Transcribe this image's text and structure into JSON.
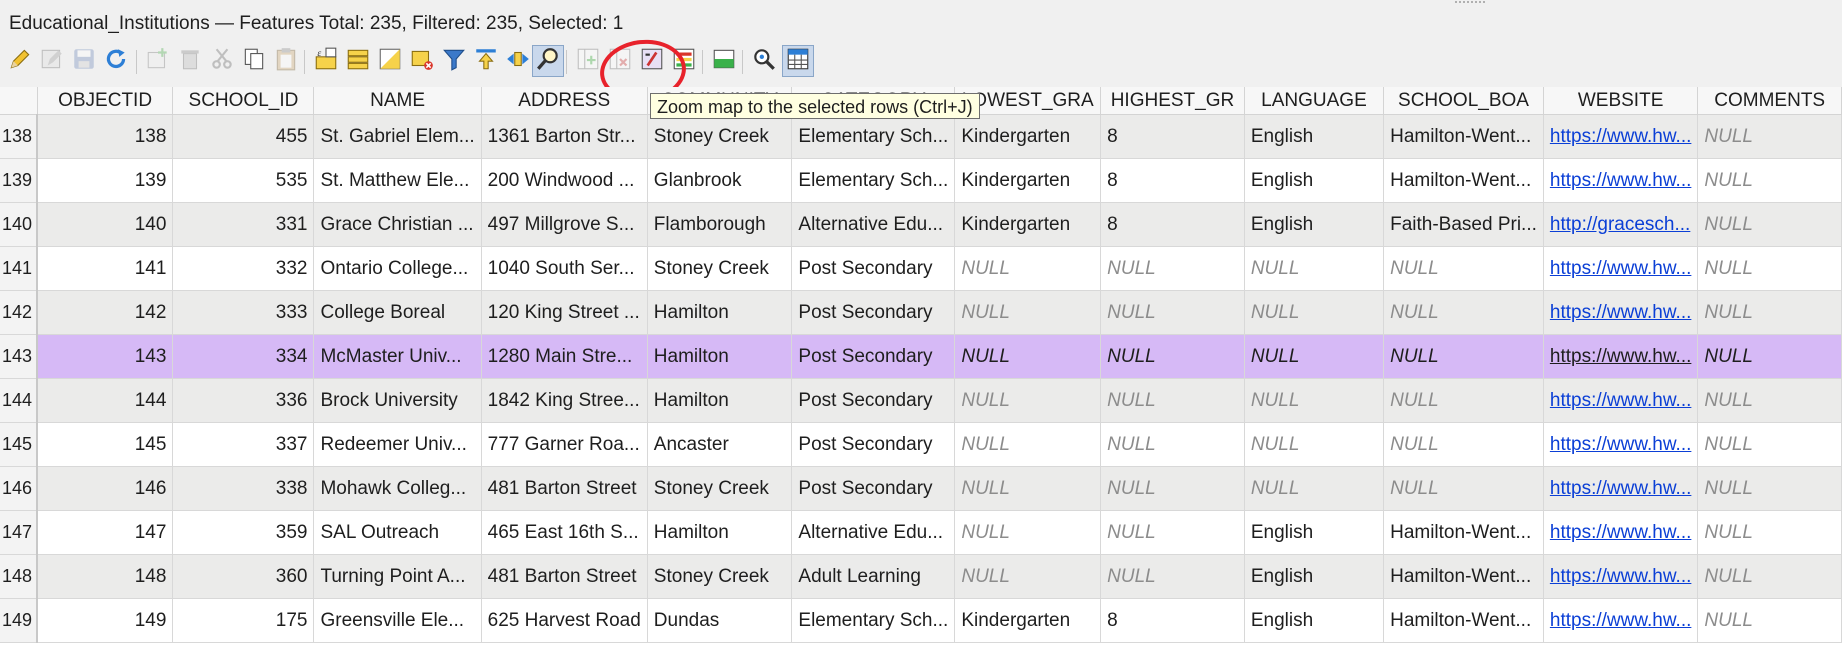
{
  "window": {
    "title": "Educational_Institutions — Features Total: 235, Filtered: 235, Selected: 1"
  },
  "toolbar": {
    "buttons": [
      {
        "icon": "pencil-icon",
        "label": "Toggle editing mode",
        "enabled": true
      },
      {
        "icon": "multi-edit-icon",
        "label": "Toggle multi edit mode",
        "enabled": false
      },
      {
        "icon": "save-icon",
        "label": "Save edits",
        "enabled": false
      },
      {
        "icon": "reload-icon",
        "label": "Reload the table",
        "enabled": true
      },
      {
        "icon": "add-feature-icon",
        "label": "Add feature",
        "enabled": false
      },
      {
        "icon": "delete-icon",
        "label": "Delete selected features",
        "enabled": false
      },
      {
        "icon": "cut-icon",
        "label": "Cut selected rows",
        "enabled": false
      },
      {
        "icon": "copy-icon",
        "label": "Copy selected rows",
        "enabled": true
      },
      {
        "icon": "paste-icon",
        "label": "Paste features",
        "enabled": false
      },
      {
        "icon": "expression-select-icon",
        "label": "Select features using an expression",
        "enabled": true
      },
      {
        "icon": "select-all-icon",
        "label": "Select all",
        "enabled": true
      },
      {
        "icon": "invert-selection-icon",
        "label": "Invert selection",
        "enabled": true
      },
      {
        "icon": "deselect-icon",
        "label": "Deselect all",
        "enabled": true
      },
      {
        "icon": "filter-icon",
        "label": "Filter/Select features using form",
        "enabled": true
      },
      {
        "icon": "move-to-top-icon",
        "label": "Move selection to top",
        "enabled": true
      },
      {
        "icon": "pan-to-selected-icon",
        "label": "Pan map to the selected rows",
        "enabled": true
      },
      {
        "icon": "zoom-to-selected-icon",
        "label": "Zoom map to the selected rows",
        "enabled": true
      },
      {
        "icon": "new-field-icon",
        "label": "New field",
        "enabled": false
      },
      {
        "icon": "delete-field-icon",
        "label": "Delete field",
        "enabled": false
      },
      {
        "icon": "field-calculator-icon",
        "label": "Open field calculator",
        "enabled": true
      },
      {
        "icon": "conditional-formatting-icon",
        "label": "Conditional formatting",
        "enabled": true
      },
      {
        "icon": "dock-icon",
        "label": "Dock attribute table",
        "enabled": true
      },
      {
        "icon": "actions-icon",
        "label": "Actions",
        "enabled": true
      },
      {
        "icon": "table-view-icon",
        "label": "Switch to table view",
        "enabled": true
      }
    ],
    "tooltip": "Zoom map to the selected rows (Ctrl+J)"
  },
  "columns": [
    "OBJECTID",
    "SCHOOL_ID",
    "NAME",
    "ADDRESS",
    "COMMUNITY",
    "CATEGORY",
    "LOWEST_GRA",
    "HIGHEST_GR",
    "LANGUAGE",
    "SCHOOL_BOA",
    "WEBSITE",
    "COMMENTS"
  ],
  "rows": [
    {
      "rownum": "138",
      "cells": [
        "138",
        "455",
        "St. Gabriel Elem...",
        "1361 Barton Str...",
        "Stoney Creek",
        "Elementary Sch...",
        "Kindergarten",
        "8",
        "English",
        "Hamilton-Went...",
        "https://www.hw...",
        "NULL"
      ]
    },
    {
      "rownum": "139",
      "cells": [
        "139",
        "535",
        "St. Matthew Ele...",
        "200 Windwood ...",
        "Glanbrook",
        "Elementary Sch...",
        "Kindergarten",
        "8",
        "English",
        "Hamilton-Went...",
        "https://www.hw...",
        "NULL"
      ]
    },
    {
      "rownum": "140",
      "cells": [
        "140",
        "331",
        "Grace Christian ...",
        "497 Millgrove S...",
        "Flamborough",
        "Alternative Edu...",
        "Kindergarten",
        "8",
        "English",
        "Faith-Based Pri...",
        "http://gracesch...",
        "NULL"
      ]
    },
    {
      "rownum": "141",
      "cells": [
        "141",
        "332",
        "Ontario College...",
        "1040 South Ser...",
        "Stoney Creek",
        "Post Secondary",
        "NULL",
        "NULL",
        "NULL",
        "NULL",
        "https://www.hw...",
        "NULL"
      ]
    },
    {
      "rownum": "142",
      "cells": [
        "142",
        "333",
        "College Boreal",
        "120 King Street ...",
        "Hamilton",
        "Post Secondary",
        "NULL",
        "NULL",
        "NULL",
        "NULL",
        "https://www.hw...",
        "NULL"
      ]
    },
    {
      "rownum": "143",
      "cells": [
        "143",
        "334",
        "McMaster Univ...",
        "1280 Main Stre...",
        "Hamilton",
        "Post Secondary",
        "NULL",
        "NULL",
        "NULL",
        "NULL",
        "https://www.hw...",
        "NULL"
      ],
      "selected": true
    },
    {
      "rownum": "144",
      "cells": [
        "144",
        "336",
        "Brock University",
        "1842 King Stree...",
        "Hamilton",
        "Post Secondary",
        "NULL",
        "NULL",
        "NULL",
        "NULL",
        "https://www.hw...",
        "NULL"
      ]
    },
    {
      "rownum": "145",
      "cells": [
        "145",
        "337",
        "Redeemer Univ...",
        "777 Garner Roa...",
        "Ancaster",
        "Post Secondary",
        "NULL",
        "NULL",
        "NULL",
        "NULL",
        "https://www.hw...",
        "NULL"
      ]
    },
    {
      "rownum": "146",
      "cells": [
        "146",
        "338",
        "Mohawk Colleg...",
        "481 Barton Street",
        "Stoney Creek",
        "Post Secondary",
        "NULL",
        "NULL",
        "NULL",
        "NULL",
        "https://www.hw...",
        "NULL"
      ]
    },
    {
      "rownum": "147",
      "cells": [
        "147",
        "359",
        "SAL Outreach",
        "465 East 16th S...",
        "Hamilton",
        "Alternative Edu...",
        "NULL",
        "NULL",
        "English",
        "Hamilton-Went...",
        "https://www.hw...",
        "NULL"
      ]
    },
    {
      "rownum": "148",
      "cells": [
        "148",
        "360",
        "Turning Point A...",
        "481 Barton Street",
        "Stoney Creek",
        "Adult Learning",
        "NULL",
        "NULL",
        "English",
        "Hamilton-Went...",
        "https://www.hw...",
        "NULL"
      ]
    },
    {
      "rownum": "149",
      "cells": [
        "149",
        "175",
        "Greensville Ele...",
        "625 Harvest Road",
        "Dundas",
        "Elementary Sch...",
        "Kindergarten",
        "8",
        "English",
        "Hamilton-Went...",
        "https://www.hw...",
        "NULL"
      ]
    }
  ],
  "colors": {
    "selected_row": "#d6b9f6",
    "alt_row": "#ebebea",
    "link": "#0b3fd6",
    "null_text": "#8c8c8c",
    "annotation_ring": "#e8222b",
    "tooltip_bg": "#ffffe1"
  }
}
